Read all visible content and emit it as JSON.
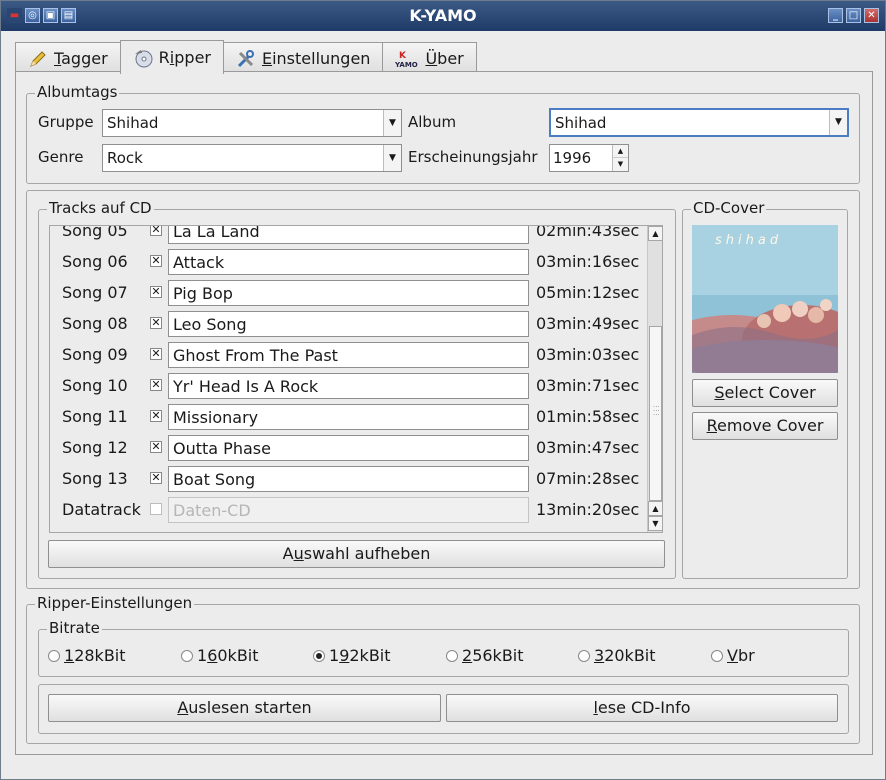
{
  "window": {
    "title": "K-YAMO"
  },
  "titlebar_buttons": {
    "minimize": "_",
    "maximize": "□",
    "close": "✕"
  },
  "tabs": [
    {
      "label_pre": "",
      "label_u": "T",
      "label_post": "agger",
      "icon": "pencil-icon"
    },
    {
      "label_pre": "R",
      "label_u": "i",
      "label_post": "pper",
      "icon": "cd-icon"
    },
    {
      "label_pre": "",
      "label_u": "E",
      "label_post": "instellungen",
      "icon": "tools-icon"
    },
    {
      "label_pre": "",
      "label_u": "Ü",
      "label_post": "ber",
      "icon": "yamo-logo-icon"
    }
  ],
  "albumtags": {
    "legend": "Albumtags",
    "gruppe_label": "Gruppe",
    "gruppe_value": "Shihad",
    "album_label": "Album",
    "album_value": "Shihad",
    "genre_label": "Genre",
    "genre_value": "Rock",
    "year_label": "Erscheinungsjahr",
    "year_value": "1996"
  },
  "tracks": {
    "legend": "Tracks auf CD",
    "rows": [
      {
        "name": "Song 05",
        "checked": true,
        "title": "La La Land",
        "time": "02min:43sec"
      },
      {
        "name": "Song 06",
        "checked": true,
        "title": "Attack",
        "time": "03min:16sec"
      },
      {
        "name": "Song 07",
        "checked": true,
        "title": "Pig Bop",
        "time": "05min:12sec"
      },
      {
        "name": "Song 08",
        "checked": true,
        "title": "Leo Song",
        "time": "03min:49sec"
      },
      {
        "name": "Song 09",
        "checked": true,
        "title": "Ghost From The Past",
        "time": "03min:03sec"
      },
      {
        "name": "Song 10",
        "checked": true,
        "title": "Yr' Head Is A Rock",
        "time": "03min:71sec"
      },
      {
        "name": "Song 11",
        "checked": true,
        "title": "Missionary",
        "time": "01min:58sec"
      },
      {
        "name": "Song 12",
        "checked": true,
        "title": "Outta Phase",
        "time": "03min:47sec"
      },
      {
        "name": "Song 13",
        "checked": true,
        "title": "Boat Song",
        "time": "07min:28sec"
      },
      {
        "name": "Datatrack",
        "checked": false,
        "title": "Daten-CD",
        "time": "13min:20sec",
        "disabled": true
      }
    ],
    "deselect_pre": "A",
    "deselect_u": "u",
    "deselect_post": "swahl aufheben"
  },
  "cover": {
    "legend": "CD-Cover",
    "image_text": "shihad",
    "select_u": "S",
    "select_post": "elect Cover",
    "remove_u": "R",
    "remove_post": "emove Cover"
  },
  "ripper": {
    "legend": "Ripper-Einstellungen",
    "bitrate_legend": "Bitrate",
    "bitrates": [
      {
        "u": "1",
        "post": "28kBit",
        "selected": false
      },
      {
        "pre": "1",
        "u": "6",
        "post": "0kBit",
        "selected": false
      },
      {
        "pre": "1",
        "u": "9",
        "post": "2kBit",
        "selected": true
      },
      {
        "u": "2",
        "post": "56kBit",
        "selected": false
      },
      {
        "u": "3",
        "post": "20kBit",
        "selected": false
      },
      {
        "u": "V",
        "post": "br",
        "selected": false
      }
    ],
    "start_u": "A",
    "start_post": "uslesen starten",
    "info_u": "l",
    "info_post": "ese CD-Info"
  },
  "colors": {
    "titlebar": "#1f3a66",
    "focus": "#4a7dc4"
  }
}
